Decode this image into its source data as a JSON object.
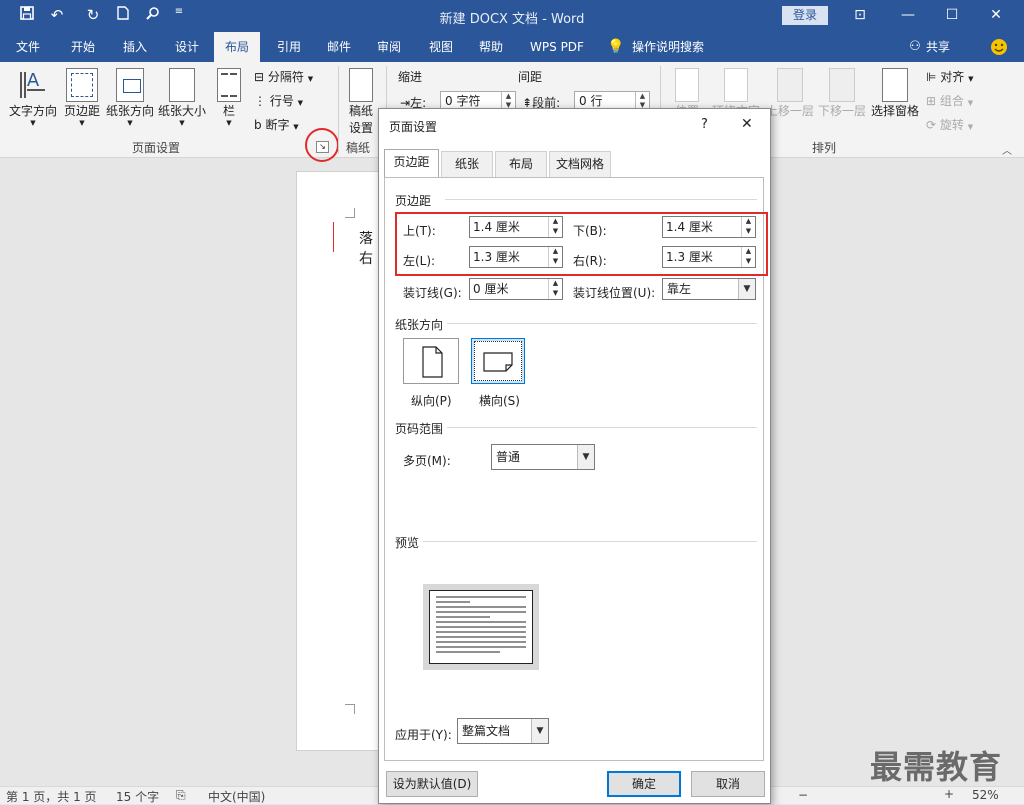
{
  "window": {
    "title": "新建 DOCX 文档  -  Word",
    "login": "登录",
    "quick_access": [
      "save-icon",
      "undo-icon",
      "redo-icon",
      "new-icon",
      "search-icon",
      "customize-icon"
    ]
  },
  "menu": {
    "items": [
      "文件",
      "开始",
      "插入",
      "设计",
      "布局",
      "引用",
      "邮件",
      "审阅",
      "视图",
      "帮助",
      "WPS PDF"
    ],
    "tell_me": "操作说明搜索",
    "share": "共享"
  },
  "ribbon": {
    "page_setup": {
      "text_direction": "文字方向",
      "margins": "页边距",
      "orientation": "纸张方向",
      "size": "纸张大小",
      "columns": "栏",
      "breaks": "分隔符",
      "line_numbers": "行号",
      "hyphenation": "断字",
      "group_label": "页面设置"
    },
    "draft": {
      "label1": "稿纸",
      "label2": "设置",
      "group_label": "稿纸"
    },
    "paragraph": {
      "indent_label": "缩进",
      "spacing_label": "间距",
      "left_label": "左:",
      "left_value": "0 字符",
      "before_label": "段前:",
      "before_value": "0 行"
    },
    "arrange": {
      "position": "位置",
      "wrap": "环绕文字",
      "forward": "上移一层",
      "backward": "下移一层",
      "selection_pane": "选择窗格",
      "align": "对齐",
      "group": "组合",
      "rotate": "旋转",
      "group_label": "排列"
    }
  },
  "document": {
    "text": "落右"
  },
  "status": {
    "page": "第 1 页，共 1 页",
    "words": "15 个字",
    "language": "中文(中国)",
    "zoom": "52%"
  },
  "watermark": "最需教育",
  "dialog": {
    "title": "页面设置",
    "help": "?",
    "close": "✕",
    "tabs": [
      "页边距",
      "纸张",
      "布局",
      "文档网格"
    ],
    "margins_section": "页边距",
    "top_label": "上(T):",
    "top_value": "1.4 厘米",
    "bottom_label": "下(B):",
    "bottom_value": "1.4 厘米",
    "left_label": "左(L):",
    "left_value": "1.3 厘米",
    "right_label": "右(R):",
    "right_value": "1.3 厘米",
    "gutter_label": "装订线(G):",
    "gutter_value": "0 厘米",
    "gutter_pos_label": "装订线位置(U):",
    "gutter_pos_value": "靠左",
    "orientation_section": "纸张方向",
    "portrait": "纵向(P)",
    "landscape": "横向(S)",
    "pages_section": "页码范围",
    "multiple_label": "多页(M):",
    "multiple_value": "普通",
    "preview_section": "预览",
    "apply_label": "应用于(Y):",
    "apply_value": "整篇文档",
    "default_button": "设为默认值(D)",
    "ok": "确定",
    "cancel": "取消"
  },
  "colors": {
    "accent": "#2b579a",
    "highlight": "#e02b2b"
  }
}
